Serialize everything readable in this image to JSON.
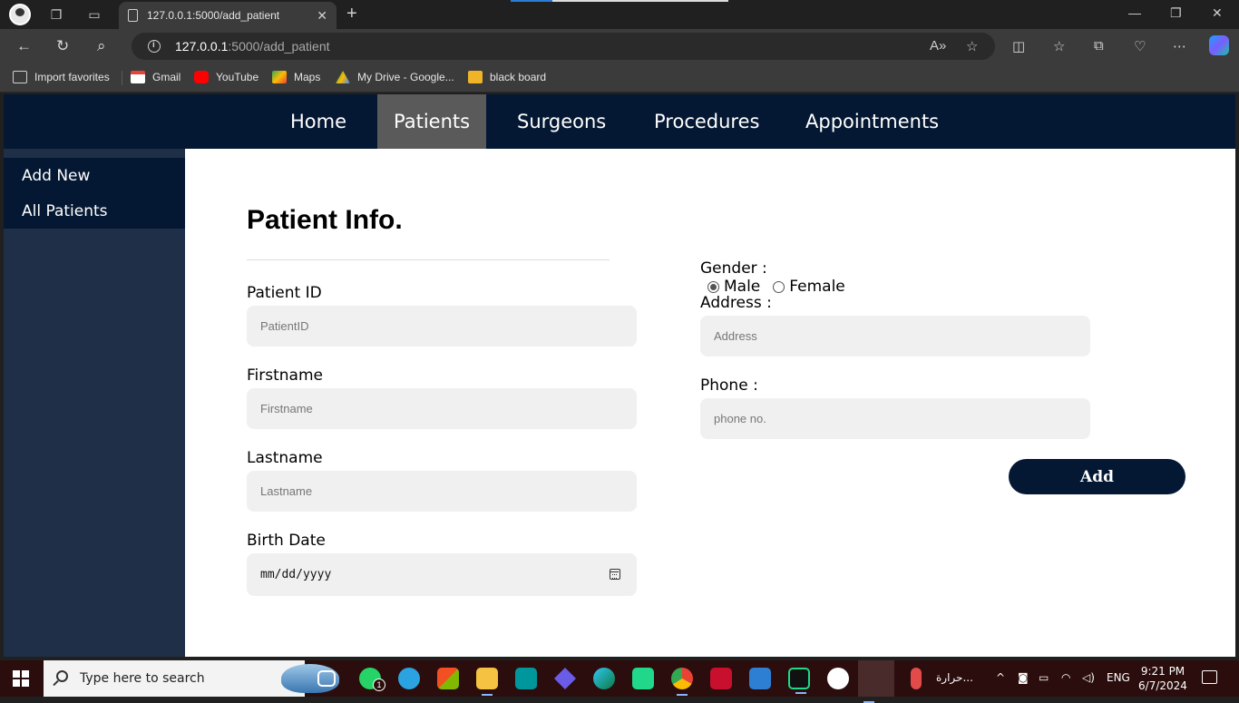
{
  "browser": {
    "tab_title": "127.0.0.1:5000/add_patient",
    "url_host": "127.0.0.1",
    "url_path": ":5000/add_patient",
    "bookmarks": [
      "Import favorites",
      "Gmail",
      "YouTube",
      "Maps",
      "My Drive - Google...",
      "black board"
    ]
  },
  "nav": {
    "items": [
      "Home",
      "Patients",
      "Surgeons",
      "Procedures",
      "Appointments"
    ],
    "active": "Patients",
    "bg_color": "#051833",
    "active_color": "#5a5a5a"
  },
  "sidebar": {
    "items": [
      "Add New",
      "All Patients"
    ]
  },
  "form": {
    "title": "Patient Info.",
    "patient_id": {
      "label": "Patient ID",
      "placeholder": "PatientID"
    },
    "firstname": {
      "label": "Firstname",
      "placeholder": "Firstname"
    },
    "lastname": {
      "label": "Lastname",
      "placeholder": "Lastname"
    },
    "birth_date": {
      "label": "Birth Date",
      "placeholder": "mm/dd/yyyy"
    },
    "gender": {
      "label": "Gender :",
      "options": [
        "Male",
        "Female"
      ],
      "selected": "Male"
    },
    "address": {
      "label": "Address :",
      "placeholder": "Address"
    },
    "phone": {
      "label": "Phone :",
      "placeholder": "phone no."
    },
    "submit_label": "Add"
  },
  "taskbar": {
    "search_placeholder": "Type here to search",
    "weather_text": "حرارة...",
    "language": "ENG",
    "time": "9:21 PM",
    "date": "6/7/2024",
    "whatsapp_badge": "1"
  }
}
